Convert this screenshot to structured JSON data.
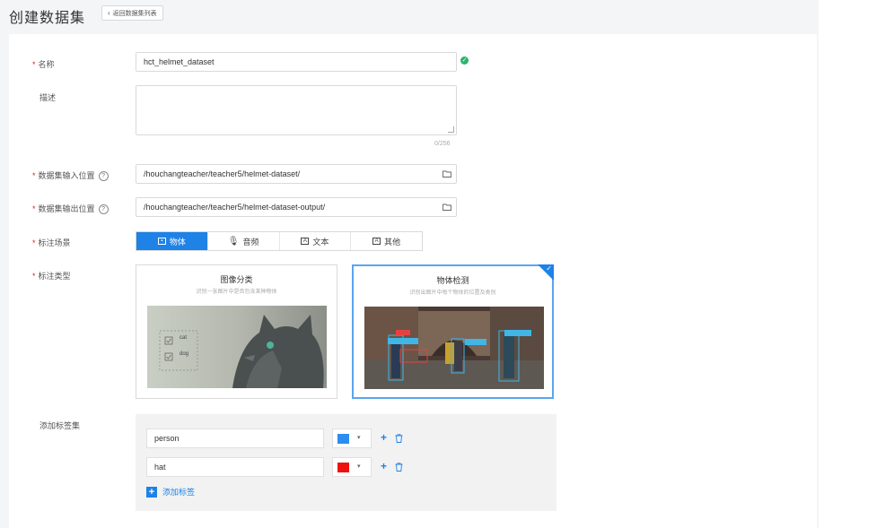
{
  "header": {
    "title": "创建数据集",
    "back_button": "返回数据集列表"
  },
  "form": {
    "name": {
      "label": "名称",
      "value": "hct_helmet_dataset"
    },
    "description": {
      "label": "描述",
      "value": "",
      "counter": "0/256"
    },
    "input_path": {
      "label": "数据集输入位置",
      "value": "/houchangteacher/teacher5/helmet-dataset/"
    },
    "output_path": {
      "label": "数据集输出位置",
      "value": "/houchangteacher/teacher5/helmet-dataset-output/"
    },
    "scene": {
      "label": "标注场景",
      "options": [
        {
          "label": "物体",
          "icon": "image-icon",
          "active": true
        },
        {
          "label": "音频",
          "icon": "microphone-icon",
          "active": false
        },
        {
          "label": "文本",
          "icon": "text-icon",
          "active": false
        },
        {
          "label": "其他",
          "icon": "other-icon",
          "active": false
        }
      ]
    },
    "annotation_type": {
      "label": "标注类型",
      "cards": [
        {
          "title": "图像分类",
          "desc": "识别一张图片中是否包含某种物体",
          "selected": false
        },
        {
          "title": "物体检测",
          "desc": "识别出图片中每个物体的位置及类别",
          "selected": true
        }
      ],
      "classification_preview_labels": [
        "cat",
        "dog"
      ]
    },
    "label_set": {
      "label": "添加标签集",
      "labels": [
        {
          "name": "person",
          "color": "#2d8cf0"
        },
        {
          "name": "hat",
          "color": "#ee1111"
        }
      ],
      "add_label": "添加标签"
    }
  },
  "colors": {
    "accent": "#1e82e6",
    "required": "#e02020",
    "success": "#2db36b"
  }
}
